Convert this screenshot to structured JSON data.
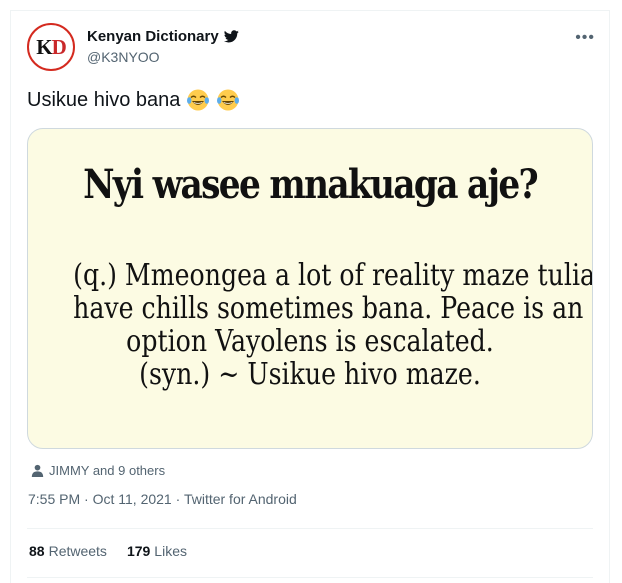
{
  "author": {
    "display_name": "Kenyan Dictionary",
    "handle": "@K3NYOO",
    "avatar_text_k": "K",
    "avatar_text_d": "D",
    "verified": false
  },
  "tweet": {
    "text": "Usikue hivo bana",
    "emoji": [
      "face-with-tears-of-joy",
      "face-with-tears-of-joy"
    ]
  },
  "media": {
    "headline": "Nyi wasee mnakuaga aje?",
    "lines": [
      "(q.) Mmeongea a lot of reality maze tulia",
      "have chills sometimes bana. Peace is an",
      "option Vayolens is escalated.",
      "(syn.) ~ Usikue hivo maze."
    ]
  },
  "likers": {
    "text": "JIMMY and 9 others"
  },
  "meta": {
    "time": "7:55 PM",
    "separator": " · ",
    "date": "Oct 11, 2021",
    "source": "Twitter for Android"
  },
  "stats": {
    "retweets_count": "88",
    "retweets_label": "Retweets",
    "likes_count": "179",
    "likes_label": "Likes"
  },
  "colors": {
    "text_primary": "#0f1419",
    "text_secondary": "#536471",
    "border": "#eff3f4",
    "media_bg": "#fcfbe3",
    "avatar_ring": "#d42a1f"
  },
  "icons": {
    "more": "more-horizontal-icon",
    "bird": "twitter-bird-icon",
    "person": "person-icon"
  }
}
